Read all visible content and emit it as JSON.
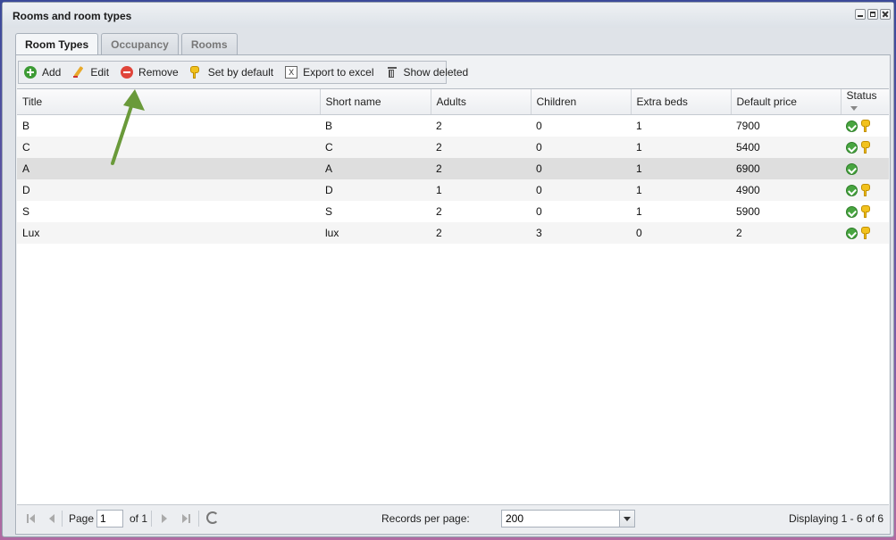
{
  "window": {
    "title": "Rooms and room types"
  },
  "tabs": [
    {
      "label": "Room Types",
      "active": true
    },
    {
      "label": "Occupancy",
      "active": false
    },
    {
      "label": "Rooms",
      "active": false
    }
  ],
  "toolbar": {
    "add_label": "Add",
    "edit_label": "Edit",
    "remove_label": "Remove",
    "set_default_label": "Set by default",
    "export_label": "Export to excel",
    "show_deleted_label": "Show deleted"
  },
  "grid": {
    "columns": [
      "Title",
      "Short name",
      "Adults",
      "Children",
      "Extra beds",
      "Default price",
      "Status"
    ],
    "rows": [
      {
        "title": "B",
        "short": "B",
        "adults": "2",
        "children": "0",
        "extra": "1",
        "price": "7900",
        "status": [
          "check-icon",
          "key-icon"
        ]
      },
      {
        "title": "C",
        "short": "C",
        "adults": "2",
        "children": "0",
        "extra": "1",
        "price": "5400",
        "status": [
          "check-icon",
          "key-icon"
        ]
      },
      {
        "title": "A",
        "short": "A",
        "adults": "2",
        "children": "0",
        "extra": "1",
        "price": "6900",
        "status": [
          "check-icon"
        ],
        "selected": true
      },
      {
        "title": "D",
        "short": "D",
        "adults": "1",
        "children": "0",
        "extra": "1",
        "price": "4900",
        "status": [
          "check-icon",
          "key-icon"
        ]
      },
      {
        "title": "S",
        "short": "S",
        "adults": "2",
        "children": "0",
        "extra": "1",
        "price": "5900",
        "status": [
          "check-icon",
          "key-icon"
        ]
      },
      {
        "title": "Lux",
        "short": "lux",
        "adults": "2",
        "children": "3",
        "extra": "0",
        "price": "2",
        "status": [
          "check-icon",
          "key-icon"
        ]
      }
    ]
  },
  "pager": {
    "page_label": "Page",
    "page_value": "1",
    "of_label": "of 1",
    "records_label": "Records per page:",
    "records_value": "200",
    "displaying": "Displaying 1 - 6 of 6"
  },
  "colors": {
    "annotation_arrow": "#6a9a3a",
    "ok": "#48a540",
    "key": "#f2c21d"
  }
}
